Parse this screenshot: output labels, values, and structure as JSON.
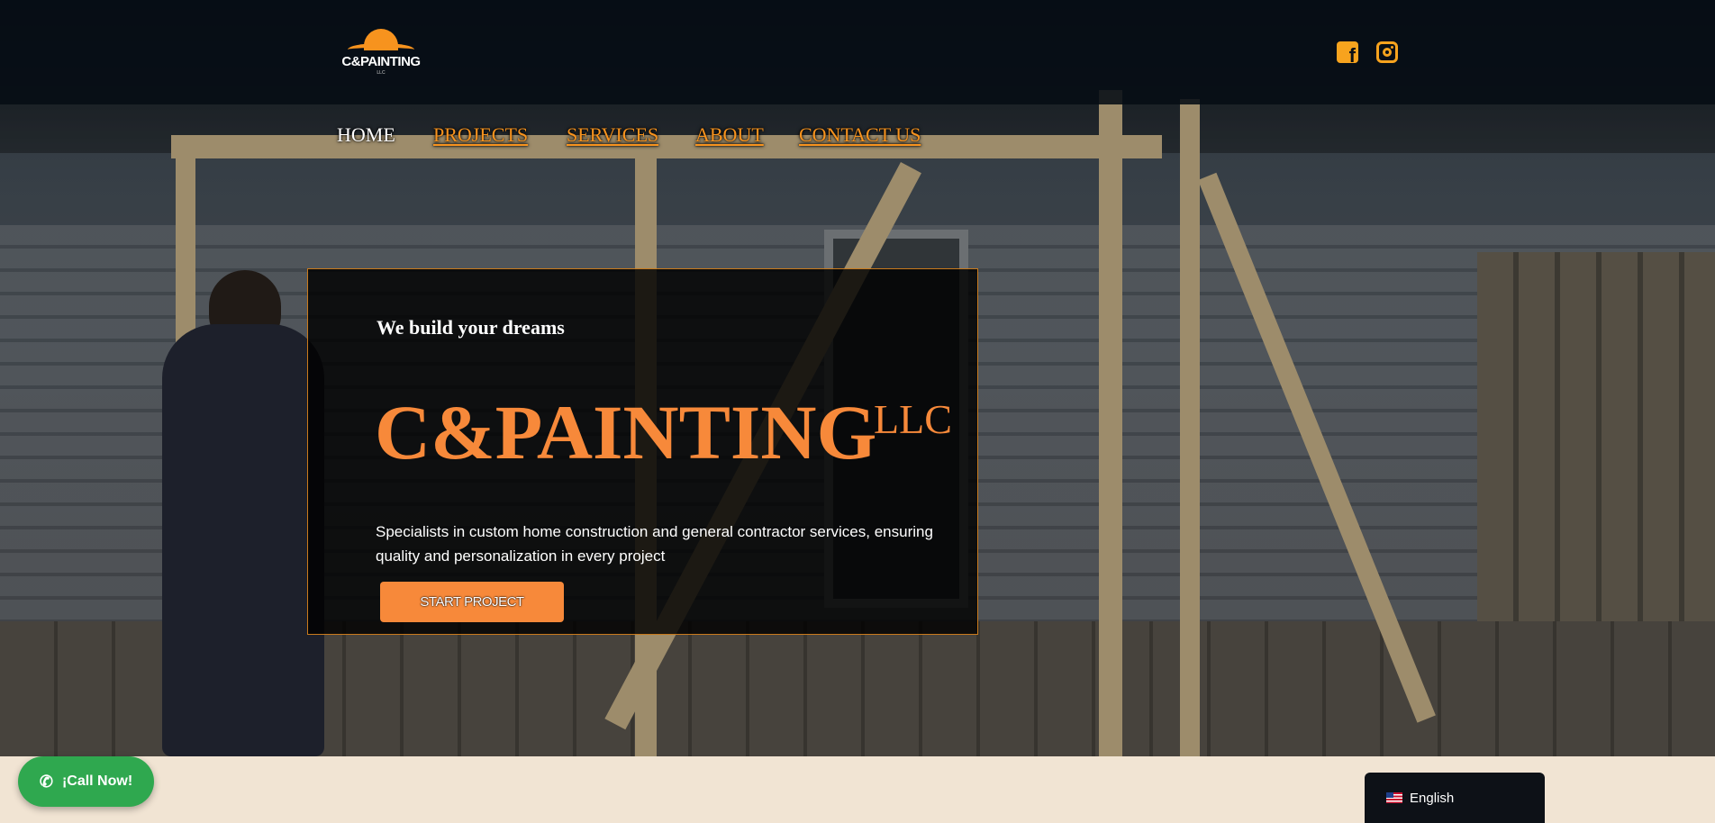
{
  "header": {
    "logo": {
      "name": "C&PAINTING",
      "sub": "LLC",
      "icon": "house-roof-sun-logo"
    },
    "social": [
      {
        "name": "facebook",
        "icon": "facebook-icon"
      },
      {
        "name": "instagram",
        "icon": "instagram-icon"
      }
    ]
  },
  "nav": {
    "items": [
      {
        "label": "HOME",
        "active": true
      },
      {
        "label": "PROJECTS",
        "active": false
      },
      {
        "label": "SERVICES",
        "active": false
      },
      {
        "label": "ABOUT",
        "active": false
      },
      {
        "label": "CONTACT US",
        "active": false
      }
    ]
  },
  "hero": {
    "tagline": "We build your dreams",
    "title": "C&PAINTING",
    "title_suffix": "LLC",
    "description": "Specialists in custom home construction and general contractor services, ensuring quality and personalization in every project",
    "cta_label": "START PROJECT"
  },
  "call_button": {
    "label": "¡Call Now!",
    "icon": "phone-icon"
  },
  "language": {
    "label": "English",
    "icon": "us-flag-icon"
  },
  "colors": {
    "accent": "#f7893a",
    "nav_link": "#f7931e",
    "card_border": "#c97a1c",
    "call_green": "#2fa84f",
    "page_bg": "#f1e4d3"
  }
}
